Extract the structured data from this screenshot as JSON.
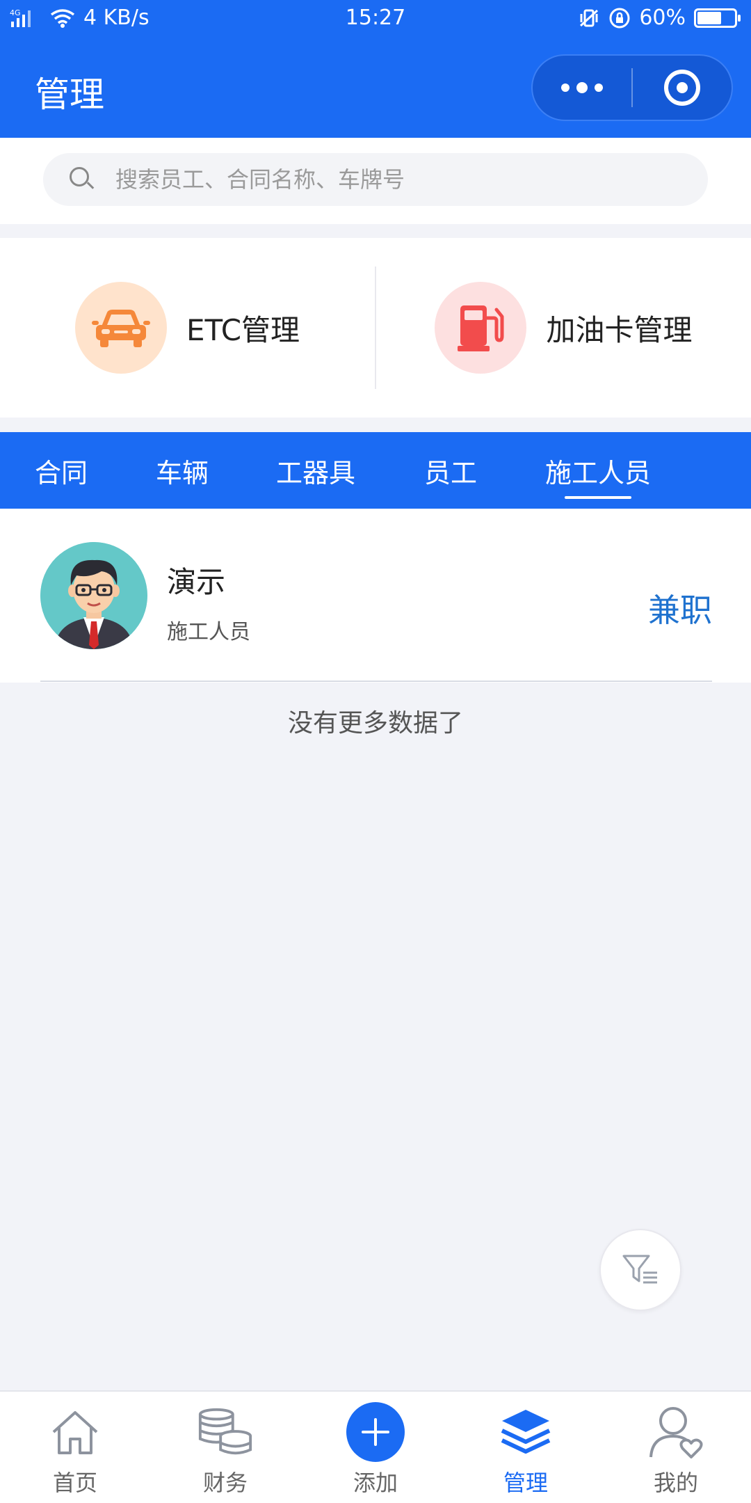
{
  "status_bar": {
    "signal": "4G",
    "speed": "4 KB/s",
    "time": "15:27",
    "battery": "60%"
  },
  "header": {
    "title": "管理"
  },
  "search": {
    "placeholder": "搜索员工、合同名称、车牌号"
  },
  "cards": [
    {
      "label": "ETC管理",
      "icon": "car-icon"
    },
    {
      "label": "加油卡管理",
      "icon": "fuel-pump-icon"
    }
  ],
  "tabs": [
    {
      "label": "合同",
      "active": false
    },
    {
      "label": "车辆",
      "active": false
    },
    {
      "label": "工器具",
      "active": false
    },
    {
      "label": "员工",
      "active": false
    },
    {
      "label": "施工人员",
      "active": true
    }
  ],
  "list": [
    {
      "name": "演示",
      "role": "施工人员",
      "type": "兼职"
    }
  ],
  "no_more": "没有更多数据了",
  "bottom_nav": [
    {
      "label": "首页",
      "icon": "home-icon",
      "active": false
    },
    {
      "label": "财务",
      "icon": "coins-icon",
      "active": false
    },
    {
      "label": "添加",
      "icon": "plus-icon",
      "active": false
    },
    {
      "label": "管理",
      "icon": "layers-icon",
      "active": true
    },
    {
      "label": "我的",
      "icon": "user-heart-icon",
      "active": false
    }
  ],
  "colors": {
    "primary": "#1b6bf3",
    "accent_text": "#1f72cf",
    "etc_circle": "#ffe3cc",
    "fuel_circle": "#fde0e0"
  }
}
